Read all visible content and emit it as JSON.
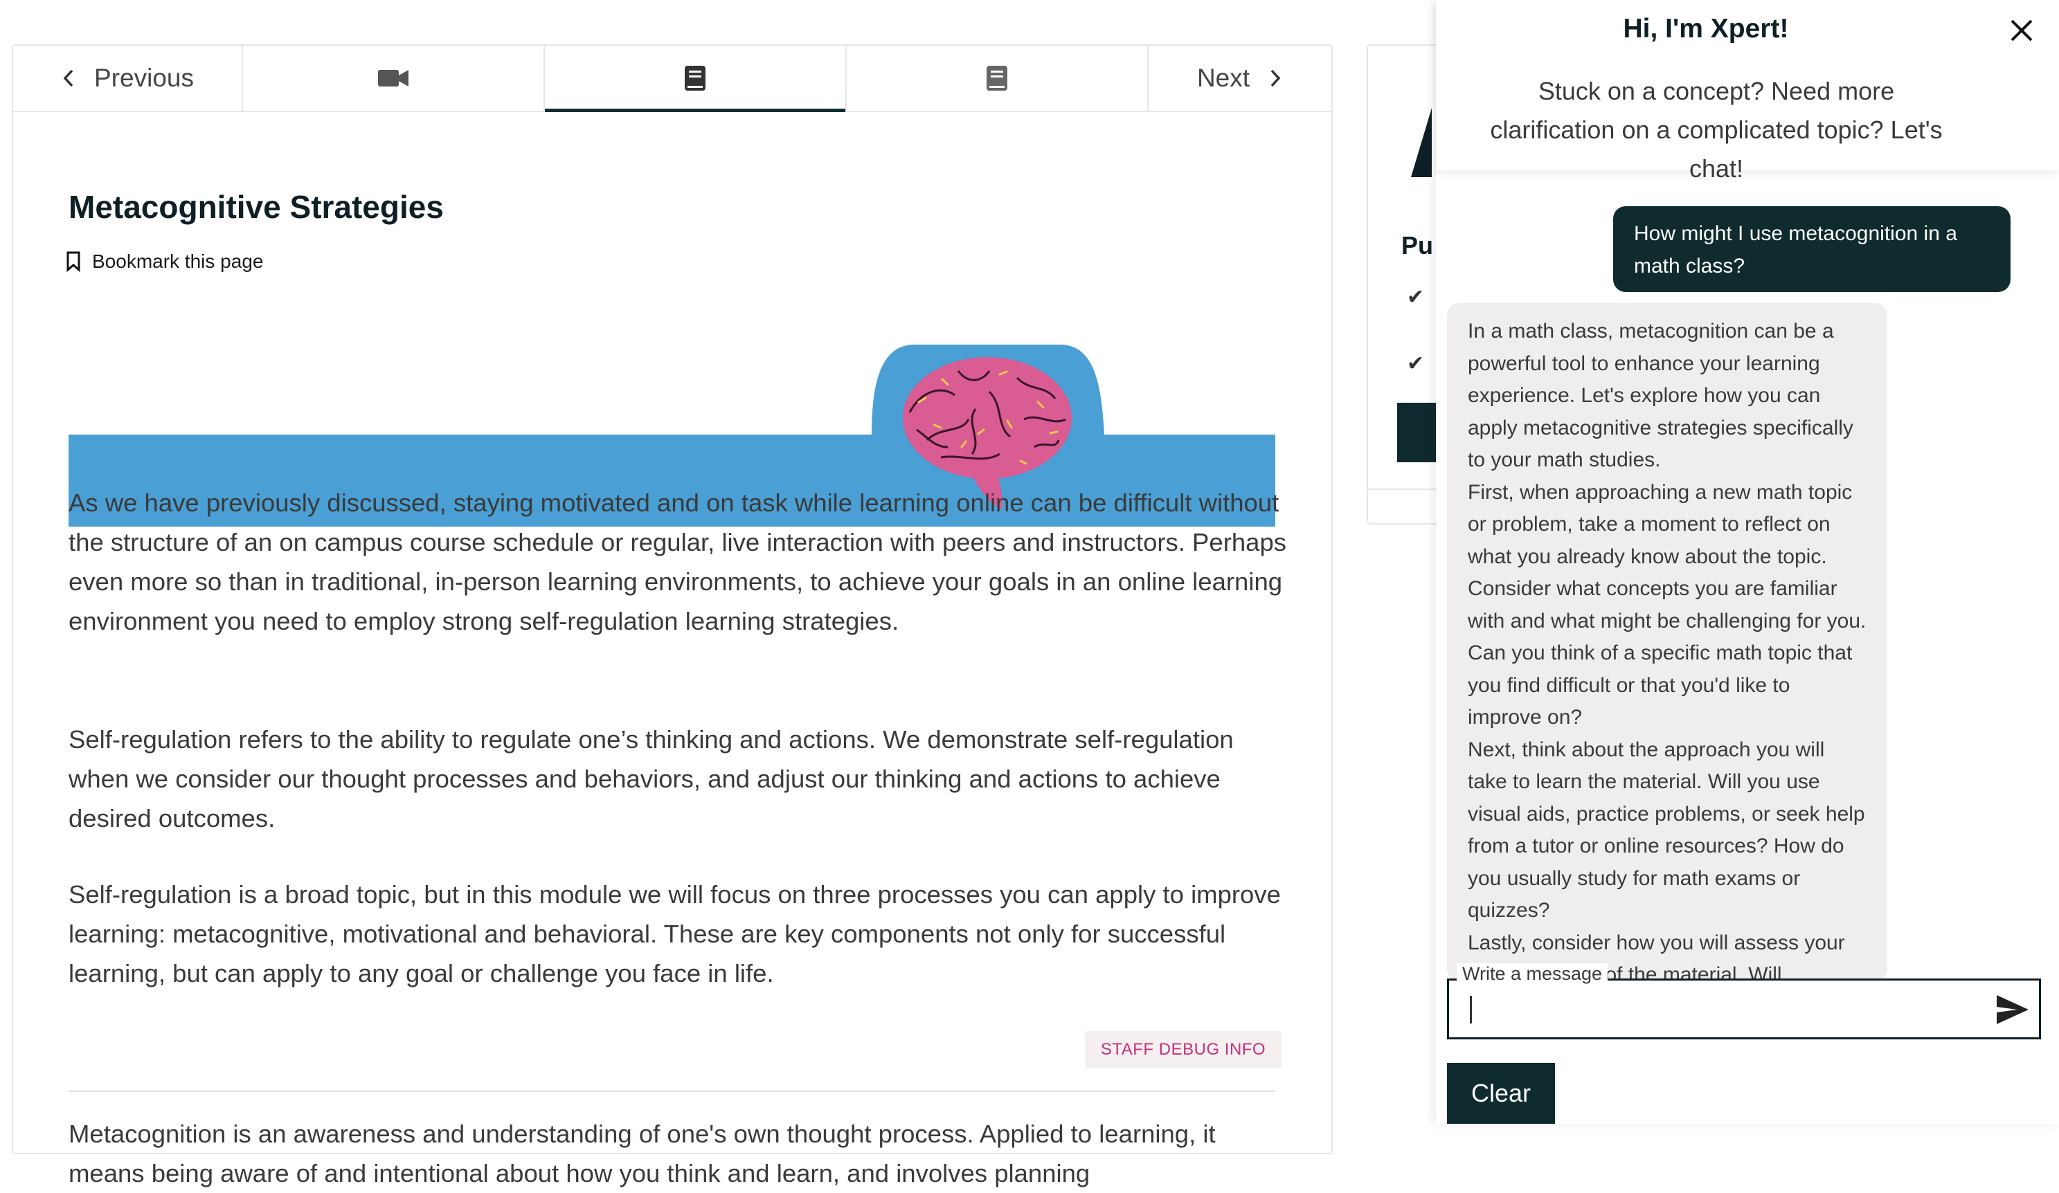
{
  "sequence_nav": {
    "previous_label": "Previous",
    "next_label": "Next",
    "tabs": [
      {
        "icon": "video-icon"
      },
      {
        "icon": "book-icon",
        "active": true
      },
      {
        "icon": "book-icon"
      }
    ]
  },
  "unit": {
    "title": "Metacognitive Strategies",
    "bookmark_label": "Bookmark this page",
    "paragraphs": [
      "As we have previously discussed, staying motivated and on task while learning online can be difficult without the structure of an on campus course schedule or regular, live interaction with peers and instructors. Perhaps even more so than in traditional, in-person learning environments, to achieve your goals in an online learning environment you need to employ strong self-regulation learning strategies.",
      "Self-regulation refers to the ability to regulate one’s thinking and actions. We demonstrate self-regulation when we consider our thought processes and behaviors, and adjust our thinking and actions to achieve desired outcomes.",
      "Self-regulation is a broad topic, but in this module we will focus on three processes you can apply to improve learning:  metacognitive, motivational and behavioral. These are key components not only for successful learning, but can apply to any goal or challenge you face in life.",
      "Metacognition is an awareness and understanding of one's own thought process. Applied to learning, it means being aware of and intentional about how you think and learn, and involves planning"
    ],
    "debug_label": "STAFF DEBUG INFO"
  },
  "sidebar_card": {
    "heading_fragment": "Pu"
  },
  "chat": {
    "title": "Hi, I'm Xpert!",
    "subtitle": "Stuck on a concept? Need more clarification on a complicated topic? Let's chat!",
    "user_message": "How might I use metacognition in a math class?",
    "bot_message": [
      "In a math class, metacognition can be a powerful tool to enhance your learning experience. Let's explore how you can apply metacognitive strategies specifically to your math studies.",
      "First, when approaching a new math topic or problem, take a moment to reflect on what you already know about the topic. Consider what concepts you are familiar with and what might be challenging for you. Can you think of a specific math topic that you find difficult or that you'd like to improve on?",
      "Next, think about the approach you will take to learn the material. Will you use visual aids, practice problems, or seek help from a tutor or online resources? How do you usually study for math exams or quizzes?",
      "Lastly, consider how you will assess your understanding of the material. Will"
    ],
    "input_label": "Write a message",
    "input_value": "",
    "clear_label": "Clear"
  },
  "colors": {
    "banner_blue": "#4a9fd4",
    "brand_dark": "#0f2b2e",
    "debug_pink": "#c2337a"
  }
}
